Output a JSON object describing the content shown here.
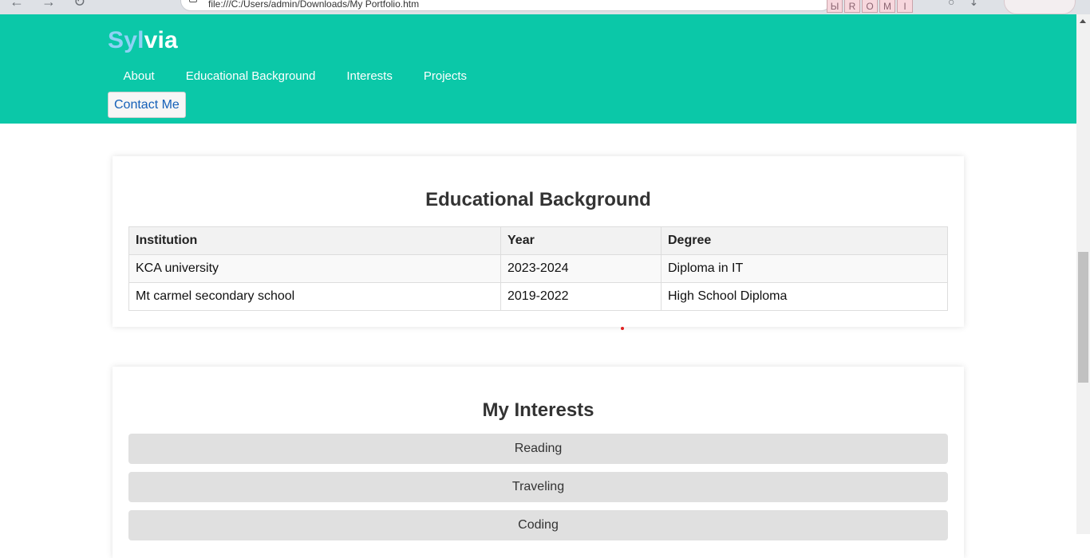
{
  "browser": {
    "url": "file:///C:/Users/admin/Downloads/My Portfolio.htm",
    "tile_letters": [
      "Ы",
      "R",
      "O",
      "M",
      "I"
    ]
  },
  "header": {
    "logo_part1": "Syl",
    "logo_part2": "via",
    "nav": [
      "About",
      "Educational Background",
      "Interests",
      "Projects"
    ],
    "contact_button": "Contact Me",
    "colors": {
      "header_bg": "#0bc8a8",
      "logo_accent": "#8fd2f5",
      "contact_text": "#1560b8"
    }
  },
  "education": {
    "title": "Educational Background",
    "columns": [
      "Institution",
      "Year",
      "Degree"
    ],
    "rows": [
      [
        "KCA university",
        "2023-2024",
        "Diploma in IT"
      ],
      [
        "Mt carmel secondary school",
        "2019-2022",
        "High School Diploma"
      ]
    ]
  },
  "interests": {
    "title": "My Interests",
    "items": [
      "Reading",
      "Traveling",
      "Coding"
    ]
  }
}
